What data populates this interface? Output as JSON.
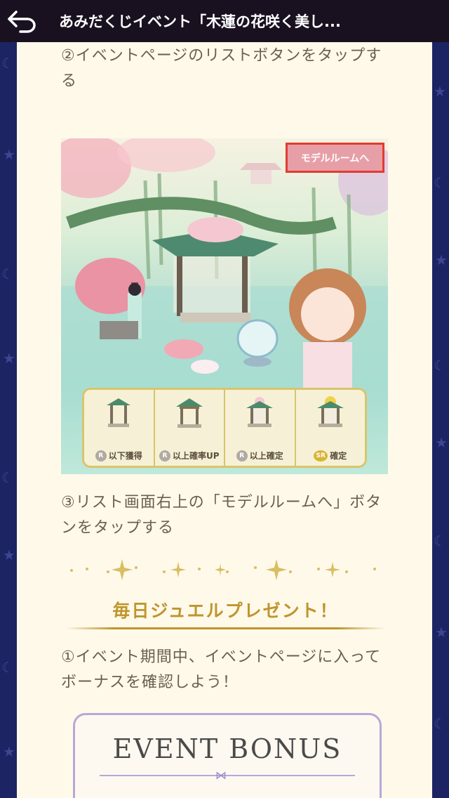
{
  "header": {
    "back_icon": "back-arrow-icon",
    "title": "あみだくじイベント「木蓮の花咲く美し..."
  },
  "content": {
    "step2_text": "②イベントページのリストボタンをタップする",
    "illustration": {
      "model_room_button": "モデルルームへ",
      "list_items": [
        {
          "rank": "R",
          "label": "以下獲得"
        },
        {
          "rank": "R",
          "label": "以上確率UP"
        },
        {
          "rank": "R",
          "label": "以上確定"
        },
        {
          "rank": "SR",
          "label": "確定"
        }
      ]
    },
    "step3_text": "③リスト画面右上の「モデルルームへ」ボタンをタップする",
    "section_title": "毎日ジュエルプレゼント！",
    "step1_text": "①イベント期間中、イベントページに入ってボーナスを確認しよう！",
    "bonus_banner": "EVENT BONUS"
  },
  "colors": {
    "header_bg": "#1a1120",
    "border_navy": "#1c2463",
    "content_bg": "#fff9ea",
    "text": "#6a5f4f",
    "gold": "#bf952c",
    "highlight_red": "#e23b30"
  }
}
